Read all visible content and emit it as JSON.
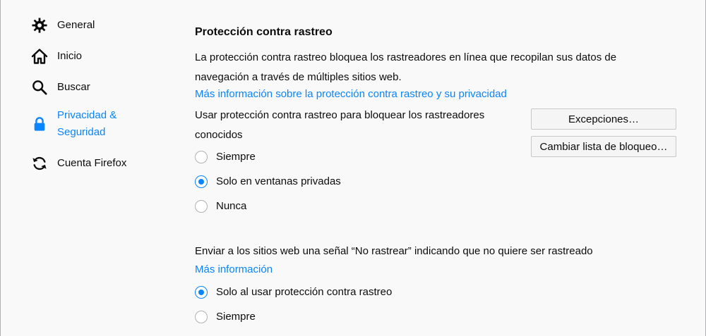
{
  "sidebar": {
    "items": [
      {
        "label": "General",
        "icon": "gear-icon",
        "selected": false
      },
      {
        "label": "Inicio",
        "icon": "home-icon",
        "selected": false
      },
      {
        "label": "Buscar",
        "icon": "search-icon",
        "selected": false
      },
      {
        "label": "Privacidad & Seguridad",
        "icon": "lock-icon",
        "selected": true
      },
      {
        "label": "Cuenta Firefox",
        "icon": "sync-icon",
        "selected": false
      }
    ]
  },
  "tracking": {
    "title": "Protección contra rastreo",
    "description": "La protección contra rastreo bloquea los rastreadores en línea que recopilan sus datos de navegación a través de múltiples sitios web.",
    "learn_more": "Más información sobre la protección contra rastreo y su privacidad",
    "use_label": "Usar protección contra rastreo para bloquear los rastreadores conocidos",
    "options": [
      {
        "label": "Siempre",
        "checked": false
      },
      {
        "label": "Solo en ventanas privadas",
        "checked": true
      },
      {
        "label": "Nunca",
        "checked": false
      }
    ],
    "exceptions_button": "Excepciones…",
    "change_blocklist_button": "Cambiar lista de bloqueo…"
  },
  "dnt": {
    "label": "Enviar a los sitios web una señal “No rastrear” indicando que no quiere ser rastreado",
    "learn_more": "Más información",
    "options": [
      {
        "label": "Solo al usar protección contra rastreo",
        "checked": true
      },
      {
        "label": "Siempre",
        "checked": false
      }
    ]
  },
  "colors": {
    "accent": "#0a84ff",
    "background": "#f9f9fa",
    "text": "#0c0c0d"
  }
}
